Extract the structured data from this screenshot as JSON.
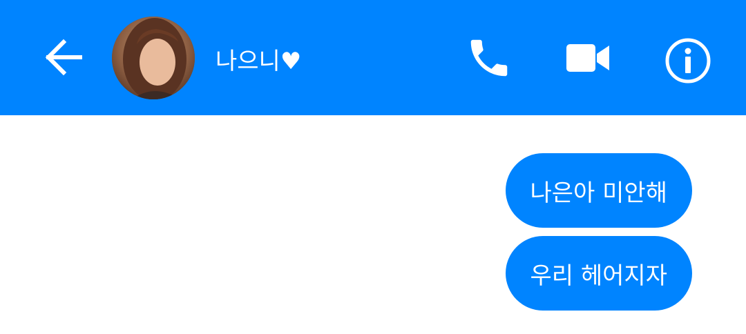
{
  "header": {
    "contact_name": "나으니♥",
    "icons": {
      "back": "arrow-left-icon",
      "call": "phone-icon",
      "video": "video-camera-icon",
      "info": "info-icon"
    },
    "background_color": "#0084ff"
  },
  "messages": [
    {
      "text": "나은아 미안해",
      "direction": "outgoing"
    },
    {
      "text": "우리 헤어지자",
      "direction": "outgoing"
    }
  ],
  "colors": {
    "accent": "#0084ff",
    "bubble_text": "#ffffff",
    "background": "#ffffff"
  }
}
